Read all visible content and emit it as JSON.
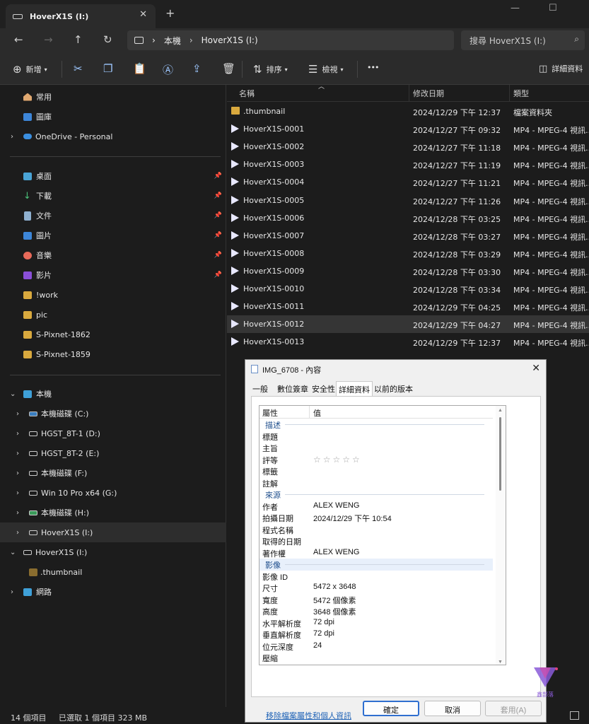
{
  "window": {
    "tab_title": "HoverX1S (I:)",
    "tab_close": "✕",
    "new_tab": "+",
    "min": "—",
    "max": "☐"
  },
  "nav": {
    "back": "←",
    "forward": "→",
    "up": "↑",
    "refresh": "↻"
  },
  "address": {
    "crumbs": [
      "本機",
      "HoverX1S (I:)"
    ],
    "sep": "›"
  },
  "search": {
    "placeholder": "搜尋 HoverX1S (I:)"
  },
  "toolbar": {
    "new_label": "新增",
    "sort_label": "排序",
    "view_label": "檢視",
    "more_label": "•••",
    "details_label": "詳細資料"
  },
  "sidebar": {
    "quick": [
      {
        "label": "常用"
      },
      {
        "label": "圖庫"
      },
      {
        "label": "OneDrive - Personal"
      }
    ],
    "pinned": [
      {
        "label": "桌面"
      },
      {
        "label": "下載"
      },
      {
        "label": "文件"
      },
      {
        "label": "圖片"
      },
      {
        "label": "音樂"
      },
      {
        "label": "影片"
      }
    ],
    "folders": [
      {
        "label": "!work"
      },
      {
        "label": "pic"
      },
      {
        "label": "S-Pixnet-1862"
      },
      {
        "label": "S-Pixnet-1859"
      }
    ],
    "pc": {
      "label": "本機"
    },
    "drives": [
      {
        "label": "本機磁碟 (C:)"
      },
      {
        "label": "HGST_8T-1 (D:)"
      },
      {
        "label": "HGST_8T-2 (E:)"
      },
      {
        "label": "本機磁碟 (F:)"
      },
      {
        "label": "Win 10 Pro x64 (G:)"
      },
      {
        "label": "本機磁碟 (H:)"
      },
      {
        "label": "HoverX1S (I:)"
      }
    ],
    "hover_root": {
      "label": "HoverX1S (I:)"
    },
    "thumb_folder": {
      "label": ".thumbnail"
    },
    "network": {
      "label": "網路"
    }
  },
  "list": {
    "columns": {
      "name": "名稱",
      "date": "修改日期",
      "type": "類型"
    },
    "rows": [
      {
        "name": ".thumbnail",
        "date": "2024/12/29 下午 12:37",
        "type": "檔案資料夾"
      },
      {
        "name": "HoverX1S-0001",
        "date": "2024/12/27 下午 09:32",
        "type": "MP4 - MPEG-4 視訊..."
      },
      {
        "name": "HoverX1S-0002",
        "date": "2024/12/27 下午 11:18",
        "type": "MP4 - MPEG-4 視訊..."
      },
      {
        "name": "HoverX1S-0003",
        "date": "2024/12/27 下午 11:19",
        "type": "MP4 - MPEG-4 視訊..."
      },
      {
        "name": "HoverX1S-0004",
        "date": "2024/12/27 下午 11:21",
        "type": "MP4 - MPEG-4 視訊..."
      },
      {
        "name": "HoverX1S-0005",
        "date": "2024/12/27 下午 11:26",
        "type": "MP4 - MPEG-4 視訊..."
      },
      {
        "name": "HoverX1S-0006",
        "date": "2024/12/28 下午 03:25",
        "type": "MP4 - MPEG-4 視訊..."
      },
      {
        "name": "HoverX1S-0007",
        "date": "2024/12/28 下午 03:27",
        "type": "MP4 - MPEG-4 視訊..."
      },
      {
        "name": "HoverX1S-0008",
        "date": "2024/12/28 下午 03:29",
        "type": "MP4 - MPEG-4 視訊..."
      },
      {
        "name": "HoverX1S-0009",
        "date": "2024/12/28 下午 03:30",
        "type": "MP4 - MPEG-4 視訊..."
      },
      {
        "name": "HoverX1S-0010",
        "date": "2024/12/28 下午 03:34",
        "type": "MP4 - MPEG-4 視訊..."
      },
      {
        "name": "HoverX1S-0011",
        "date": "2024/12/29 下午 04:25",
        "type": "MP4 - MPEG-4 視訊..."
      },
      {
        "name": "HoverX1S-0012",
        "date": "2024/12/29 下午 04:27",
        "type": "MP4 - MPEG-4 視訊..."
      },
      {
        "name": "HoverX1S-0013",
        "date": "2024/12/29 下午 12:37",
        "type": "MP4 - MPEG-4 視訊..."
      }
    ]
  },
  "status": {
    "count": "14 個項目",
    "selected": "已選取 1 個項目 323 MB"
  },
  "dialog": {
    "title": "IMG_6708 - 內容",
    "close": "✕",
    "tabs": [
      "一般",
      "數位簽章",
      "安全性",
      "詳細資料",
      "以前的版本"
    ],
    "header": {
      "prop": "屬性",
      "value": "值"
    },
    "rows": [
      {
        "k": "描述",
        "grp": true
      },
      {
        "k": "標題",
        "v": ""
      },
      {
        "k": "主旨",
        "v": ""
      },
      {
        "k": "評等",
        "v": "☆☆☆☆☆"
      },
      {
        "k": "標籤",
        "v": ""
      },
      {
        "k": "註解",
        "v": ""
      },
      {
        "k": "來源",
        "grp": true
      },
      {
        "k": "作者",
        "v": "ALEX WENG"
      },
      {
        "k": "拍攝日期",
        "v": "2024/12/29 下午 10:54"
      },
      {
        "k": "程式名稱",
        "v": ""
      },
      {
        "k": "取得的日期",
        "v": ""
      },
      {
        "k": "著作權",
        "v": "ALEX WENG"
      },
      {
        "k": "影像",
        "grp": true,
        "hl": true
      },
      {
        "k": "影像 ID",
        "v": ""
      },
      {
        "k": "尺寸",
        "v": "5472 x 3648"
      },
      {
        "k": "寬度",
        "v": "5472 個像素"
      },
      {
        "k": "高度",
        "v": "3648 個像素"
      },
      {
        "k": "水平解析度",
        "v": "72 dpi"
      },
      {
        "k": "垂直解析度",
        "v": "72 dpi"
      },
      {
        "k": "位元深度",
        "v": "24"
      },
      {
        "k": "壓縮",
        "v": ""
      }
    ],
    "remove_link": "移除檔案屬性和個人資訊",
    "ok": "確定",
    "cancel": "取消",
    "apply": "套用(A)"
  },
  "watermark": {
    "text": "鑫部落"
  }
}
